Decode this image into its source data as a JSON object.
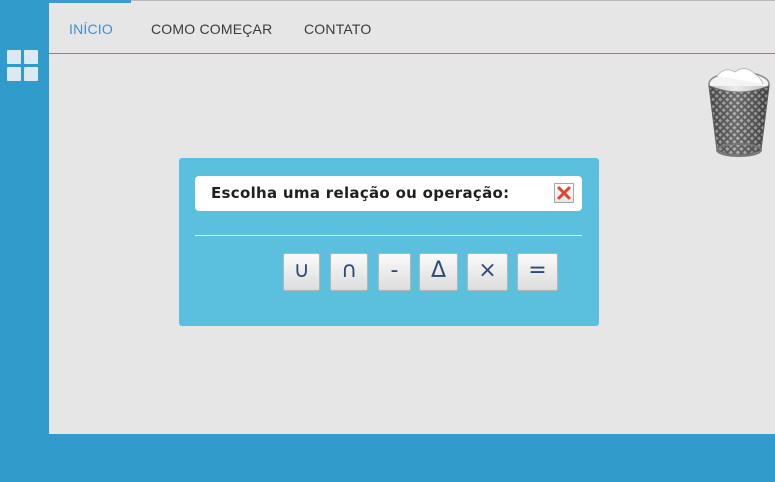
{
  "nav": {
    "items": [
      {
        "label": "INÍCIO",
        "active": true
      },
      {
        "label": "COMO COMEÇAR",
        "active": false
      },
      {
        "label": "CONTATO",
        "active": false
      }
    ]
  },
  "sidebar": {
    "icon": "grid-icon"
  },
  "trash": {
    "icon": "trash-bin-icon"
  },
  "dialog": {
    "title": "Escolha uma relação ou operação:",
    "close_icon": "close-icon",
    "operations": [
      {
        "symbol": "∪",
        "name": "union"
      },
      {
        "symbol": "∩",
        "name": "intersection"
      },
      {
        "symbol": "-",
        "name": "difference"
      },
      {
        "symbol": "Δ",
        "name": "symmetric-difference"
      },
      {
        "symbol": "×",
        "name": "cartesian-product"
      },
      {
        "symbol": "=",
        "name": "equality"
      }
    ]
  },
  "colors": {
    "sidebar": "#319ccc",
    "dialog": "#5bbfde",
    "accent": "#3d8fd6"
  }
}
